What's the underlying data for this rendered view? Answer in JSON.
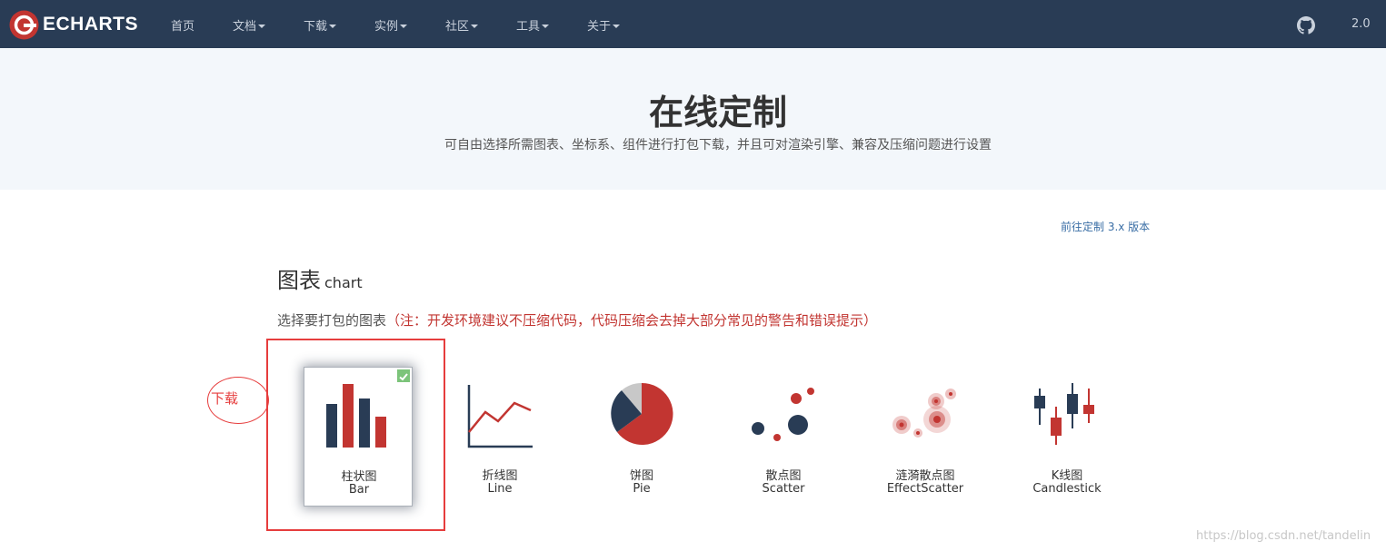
{
  "nav": {
    "logo_text": "ECHARTS",
    "items": [
      {
        "label": "首页",
        "dropdown": false
      },
      {
        "label": "文档",
        "dropdown": true
      },
      {
        "label": "下载",
        "dropdown": true
      },
      {
        "label": "实例",
        "dropdown": true
      },
      {
        "label": "社区",
        "dropdown": true
      },
      {
        "label": "工具",
        "dropdown": true
      },
      {
        "label": "关于",
        "dropdown": true
      }
    ],
    "version": "2.0",
    "github_icon": "github-icon"
  },
  "hero": {
    "title": "在线定制",
    "subtitle": "可自由选择所需图表、坐标系、组件进行打包下载，并且可对渲染引擎、兼容及压缩问题进行设置"
  },
  "link_3x": "前往定制 3.x 版本",
  "section": {
    "title": "图表",
    "title_en": "chart",
    "desc": "选择要打包的图表",
    "note": "（注：开发环境建议不压缩代码，代码压缩会去掉大部分常见的警告和错误提示）"
  },
  "annotation": {
    "label": "下载"
  },
  "charts": [
    {
      "zh": "柱状图",
      "en": "Bar",
      "icon": "bar-chart-icon",
      "selected": true
    },
    {
      "zh": "折线图",
      "en": "Line",
      "icon": "line-chart-icon",
      "selected": false
    },
    {
      "zh": "饼图",
      "en": "Pie",
      "icon": "pie-chart-icon",
      "selected": false
    },
    {
      "zh": "散点图",
      "en": "Scatter",
      "icon": "scatter-chart-icon",
      "selected": false
    },
    {
      "zh": "涟漪散点图",
      "en": "EffectScatter",
      "icon": "effect-scatter-icon",
      "selected": false
    },
    {
      "zh": "K线图",
      "en": "Candlestick",
      "icon": "candlestick-icon",
      "selected": false
    }
  ],
  "colors": {
    "navy": "#293c55",
    "red": "#c23531",
    "grey": "#c8c8c8",
    "check": "#7cc47a"
  },
  "watermark": "https://blog.csdn.net/tandelin"
}
